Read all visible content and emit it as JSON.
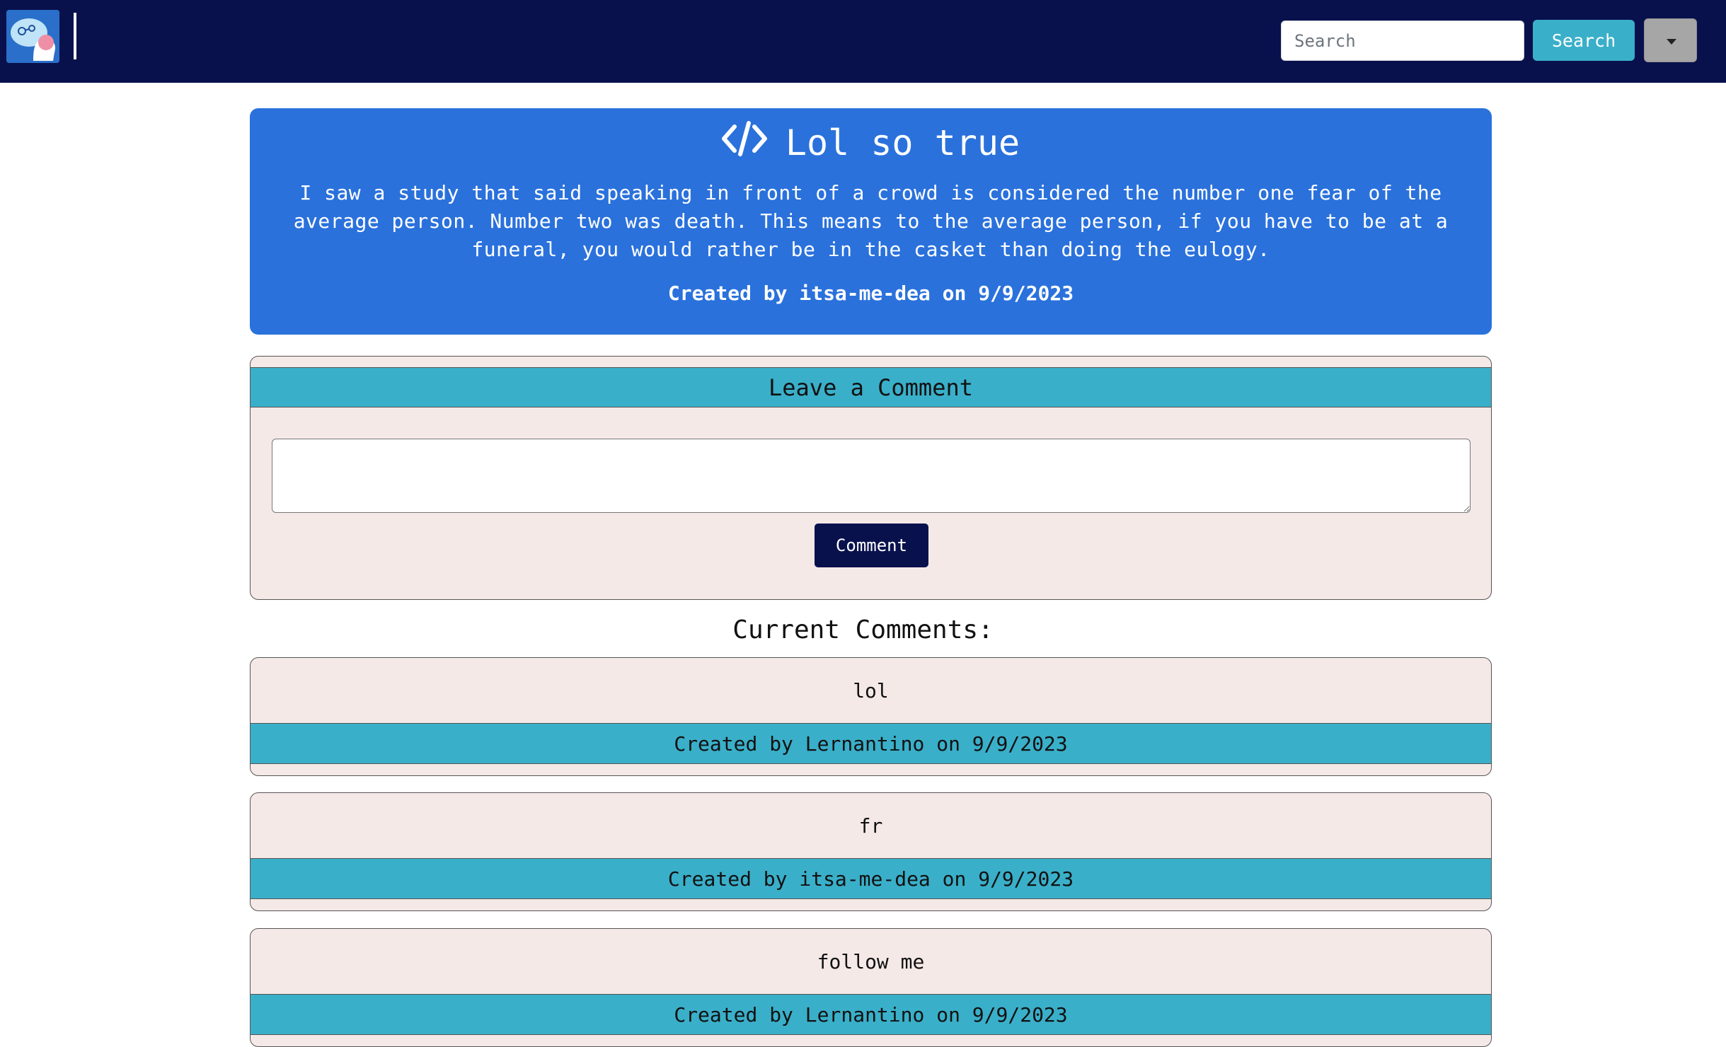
{
  "nav": {
    "search_placeholder": "Search",
    "search_button": "Search",
    "logo_icon": "brain-chat-logo-icon",
    "dropdown_icon": "caret-down-icon"
  },
  "post": {
    "icon": "code-icon",
    "title": "Lol so true",
    "body": "I saw a study that said speaking in front of a crowd is considered the number one fear of the average person. Number two was death. This means to the average person, if you have to be at a funeral, you would rather be in the casket than doing the eulogy.",
    "meta": "Created by itsa-me-dea on 9/9/2023"
  },
  "comment_form": {
    "header": "Leave a Comment",
    "textarea_value": "",
    "submit_label": "Comment"
  },
  "comments_heading": "Current Comments:",
  "comments": [
    {
      "text": "lol",
      "meta": "Created by Lernantino on 9/9/2023"
    },
    {
      "text": "fr",
      "meta": "Created by itsa-me-dea on 9/9/2023"
    },
    {
      "text": "follow me",
      "meta": "Created by Lernantino on 9/9/2023"
    }
  ],
  "colors": {
    "navbar": "#09114d",
    "post_card": "#2a71dc",
    "accent_teal": "#3aafc9",
    "card_bg": "#f5e9e8"
  }
}
